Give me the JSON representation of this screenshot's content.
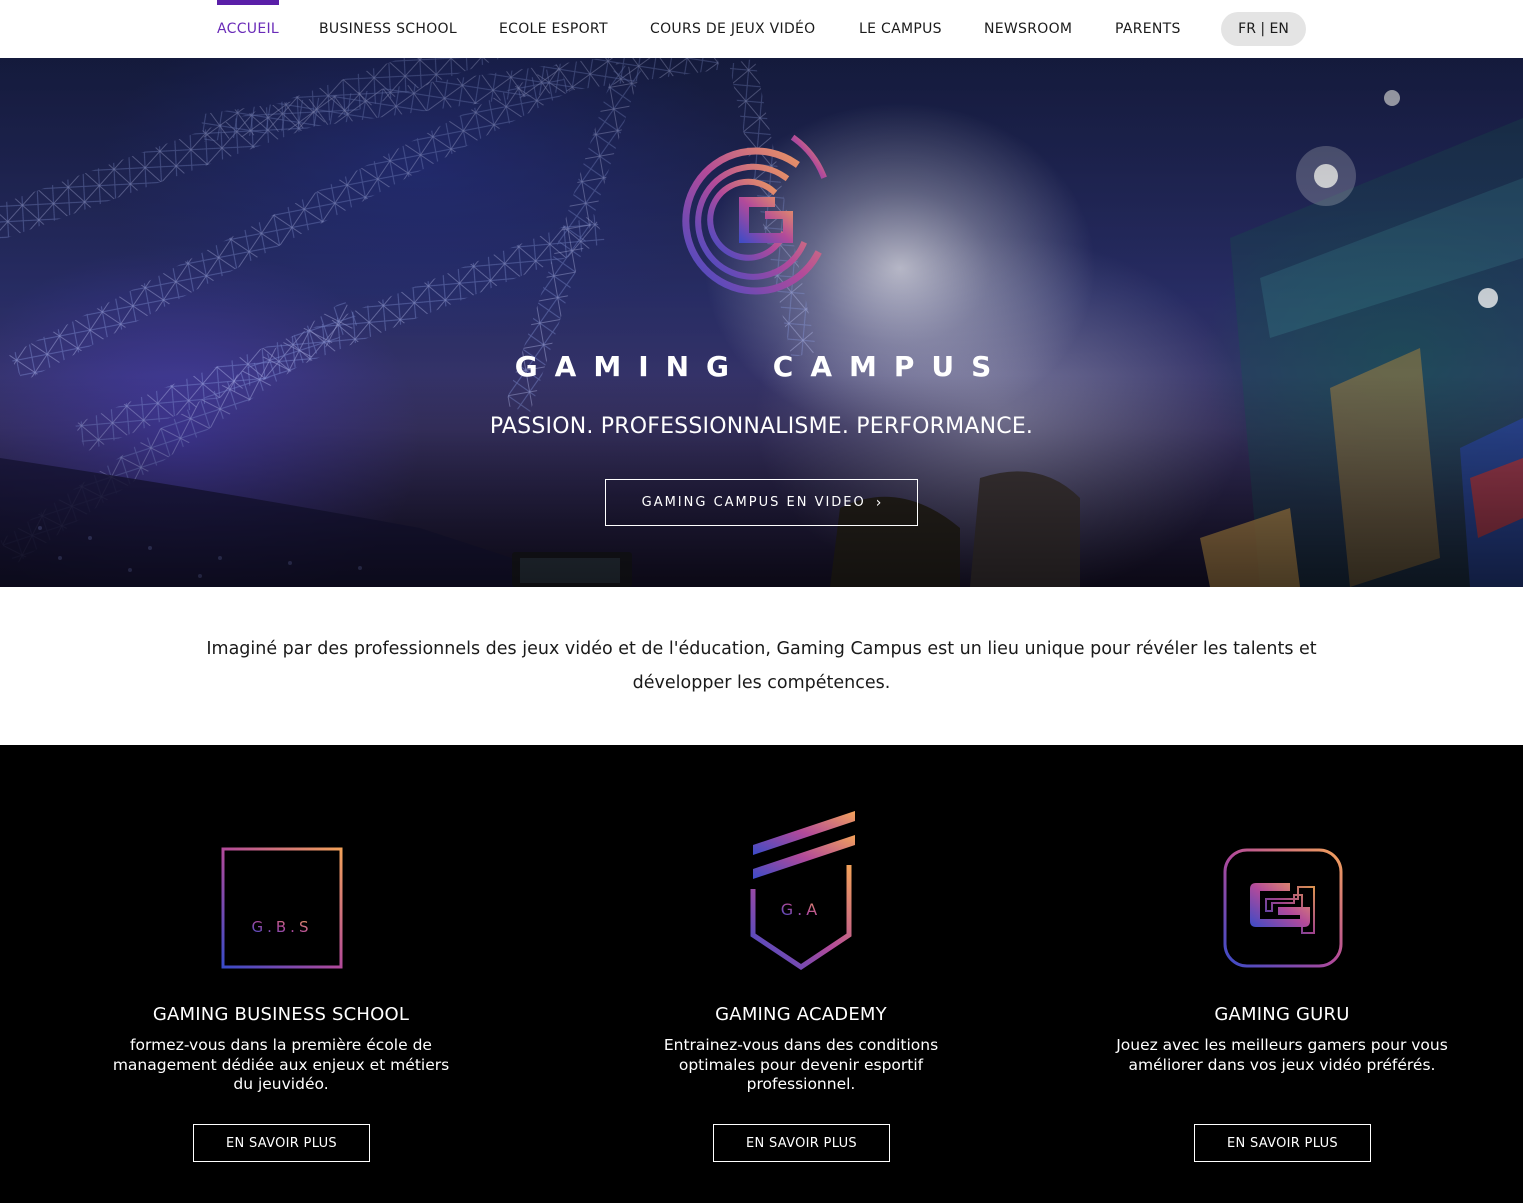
{
  "nav": {
    "items": [
      {
        "label": "ACCUEIL",
        "active": true
      },
      {
        "label": "BUSINESS SCHOOL"
      },
      {
        "label": "ECOLE ESPORT"
      },
      {
        "label": "COURS DE JEUX VIDÉO"
      },
      {
        "label": "LE CAMPUS"
      },
      {
        "label": "NEWSROOM"
      },
      {
        "label": "PARENTS"
      }
    ],
    "lang": "FR | EN",
    "active_color": "#5a1fa8"
  },
  "hero": {
    "brand": "GAMING CAMPUS",
    "tagline": "PASSION. PROFESSIONNALISME. PERFORMANCE.",
    "video_button": "GAMING CAMPUS EN VIDEO",
    "video_button_icon": "chevron-right-icon"
  },
  "intro": {
    "text": "Imaginé par des professionnels des jeux vidéo et de l'éducation, Gaming Campus est un lieu unique pour révéler les talents et développer les compétences."
  },
  "programs": [
    {
      "icon": "gbs-square-icon",
      "icon_text": "G.B.S",
      "title": "GAMING BUSINESS SCHOOL",
      "description": "formez-vous dans la première école de management dédiée aux enjeux et métiers du jeuvidéo.",
      "button": "EN SAVOIR PLUS"
    },
    {
      "icon": "ga-shield-icon",
      "icon_text": "G.A",
      "title": "GAMING ACADEMY",
      "description": "Entrainez-vous dans des conditions optimales pour devenir esportif professionnel.",
      "button": "EN SAVOIR PLUS"
    },
    {
      "icon": "gg-rounded-square-icon",
      "title": "GAMING GURU",
      "description": "Jouez avec les meilleurs gamers pour vous améliorer dans vos jeux vidéo préférés.",
      "button": "EN SAVOIR PLUS"
    }
  ],
  "colors": {
    "gradient_start": "#3a4bc8",
    "gradient_mid": "#b24a9a",
    "gradient_end": "#f3a25a"
  }
}
